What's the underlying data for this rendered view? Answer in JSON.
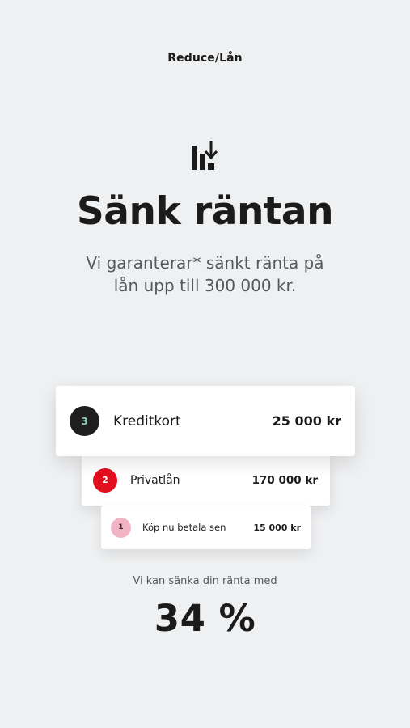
{
  "header": {
    "title": "Reduce/Lån"
  },
  "hero": {
    "icon": "bar-chart-down-icon",
    "title": "Sänk räntan",
    "subtitle": "Vi garanterar* sänkt ränta på lån upp till 300 000 kr."
  },
  "loans": [
    {
      "number": "3",
      "label": "Kreditkort",
      "amount": "25 000 kr",
      "badge_color": "#1e1e1e",
      "number_color": "#8fd1b8"
    },
    {
      "number": "2",
      "label": "Privatlån",
      "amount": "170 000 kr",
      "badge_color": "#e20f1e",
      "number_color": "#ffffff"
    },
    {
      "number": "1",
      "label": "Köp nu betala sen",
      "amount": "15 000 kr",
      "badge_color": "#f2b4c4",
      "number_color": "#3a2a2e"
    }
  ],
  "result": {
    "caption": "Vi kan sänka din ränta med",
    "value": "34 %"
  },
  "colors": {
    "background": "#eff0f1",
    "text": "#1b1b1b",
    "muted": "#55585c"
  }
}
